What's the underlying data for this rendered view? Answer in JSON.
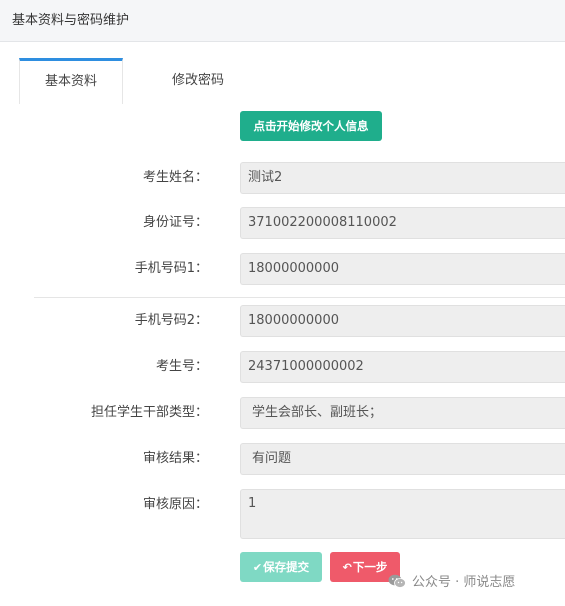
{
  "header": {
    "title": "基本资料与密码维护"
  },
  "tabs": [
    {
      "label": "基本资料"
    },
    {
      "label": "修改密码"
    }
  ],
  "edit_button": {
    "label": "点击开始修改个人信息"
  },
  "fields": [
    {
      "label": "考生姓名：",
      "value": "测试2"
    },
    {
      "label": "身份证号：",
      "value": "371002200008110002"
    },
    {
      "label": "手机号码1：",
      "value": "18000000000"
    },
    {
      "label": "手机号码2：",
      "value": "18000000000"
    },
    {
      "label": "考生号：",
      "value": "24371000000002"
    },
    {
      "label": "担任学生干部类型：",
      "value": "学生会部长、副班长；"
    },
    {
      "label": "审核结果：",
      "value": "有问题"
    },
    {
      "label": "审核原因：",
      "value": "1"
    }
  ],
  "actions": {
    "save_label": "保存提交",
    "next_label": "下一步"
  },
  "watermark": {
    "text": "公众号 · 师说志愿"
  }
}
